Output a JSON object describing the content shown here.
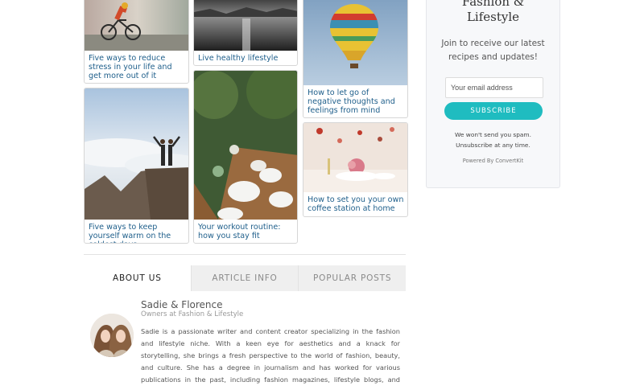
{
  "posts": [
    {
      "title": "Five ways to reduce stress in your life and get more out of it"
    },
    {
      "title": "Five ways to keep yourself warm on the coldest days"
    },
    {
      "title": "Live healthy lifestyle"
    },
    {
      "title": "Your workout routine: how you stay fit"
    },
    {
      "title": "How to let go of negative thoughts and feelings from mind"
    },
    {
      "title": "How to set you your own coffee station at home"
    }
  ],
  "tabs": [
    {
      "label": "ABOUT US",
      "active": true
    },
    {
      "label": "ARTICLE INFO",
      "active": false
    },
    {
      "label": "POPULAR POSTS",
      "active": false
    }
  ],
  "author": {
    "name": "Sadie & Florence",
    "role": "Owners at Fashion & Lifestyle",
    "bio": "Sadie is a passionate writer and content creator specializing in the fashion and lifestyle niche. With a keen eye for aesthetics and a knack for storytelling, she brings a fresh perspective to the world of fashion, beauty, and culture. She has a degree in journalism and has worked for various publications in the past, including fashion magazines, lifestyle blogs, and online media outlets."
  },
  "newsletter": {
    "title_line1": "Fashion &",
    "title_line2": "Lifestyle",
    "desc_line1": "Join to receive our latest",
    "desc_line2": "recipes and updates!",
    "email_placeholder": "Your email address",
    "button_label": "SUBSCRIBE",
    "spam_line1": "We won't send you spam.",
    "spam_line2": "Unsubscribe at any time.",
    "powered_by": "Powered By ConvertKit"
  },
  "colors": {
    "link": "#1f5f8b",
    "accent": "#1fbcc0"
  }
}
